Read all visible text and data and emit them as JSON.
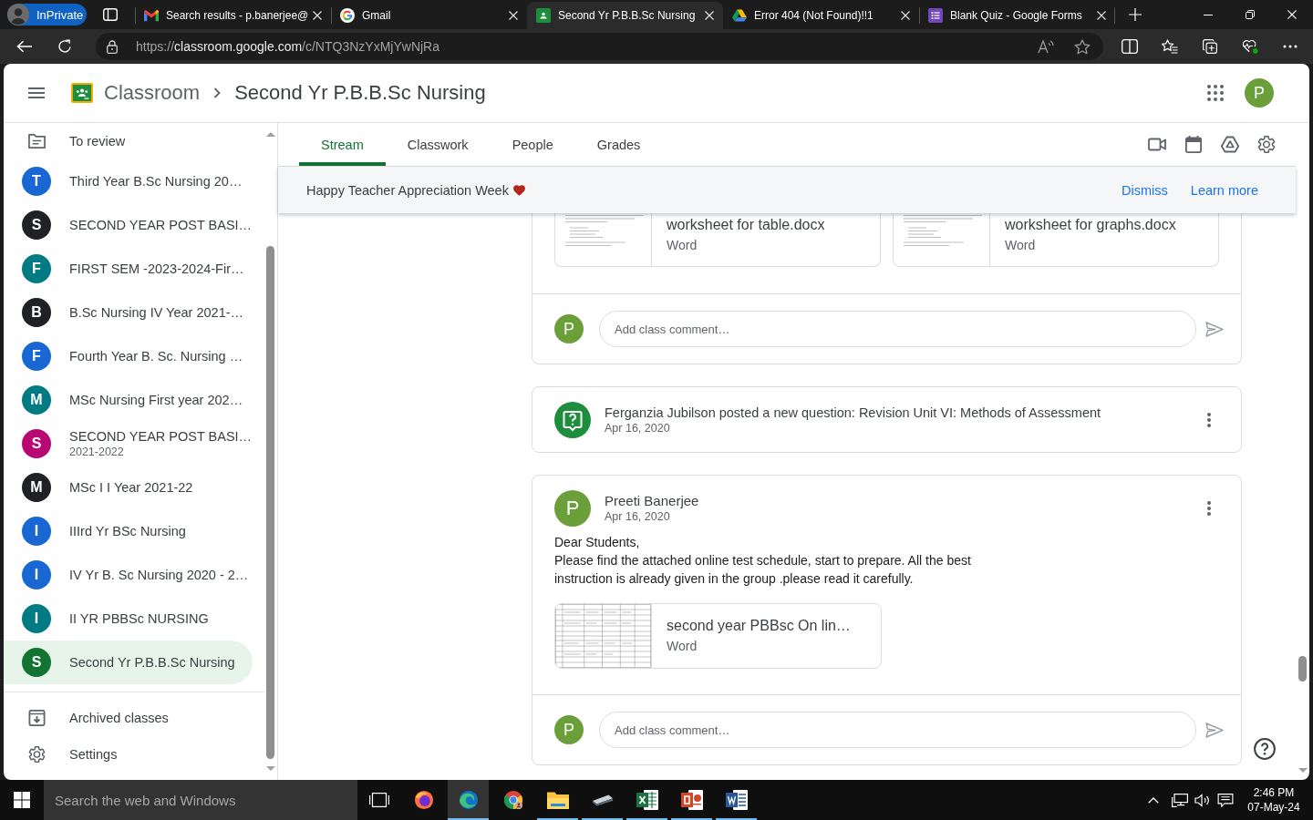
{
  "browser": {
    "profile_label": "InPrivate",
    "tabs": [
      {
        "title": "Search results - p.banerjee@",
        "kind": "gmail",
        "selected": false
      },
      {
        "title": "Gmail",
        "kind": "google",
        "selected": false
      },
      {
        "title": "Second Yr P.B.B.Sc Nursing",
        "kind": "classroom",
        "selected": true
      },
      {
        "title": "Error 404 (Not Found)!!1",
        "kind": "drive",
        "selected": false
      },
      {
        "title": "Blank Quiz - Google Forms",
        "kind": "forms",
        "selected": false
      }
    ],
    "address": {
      "scheme": "https://",
      "host": "classroom.google.com",
      "path": "/c/NTQ3NzYxMjYwNjRa"
    }
  },
  "app_bar": {
    "product": "Classroom",
    "breadcrumb": "Second Yr P.B.B.Sc Nursing",
    "account_initial": "P"
  },
  "sidebar": {
    "review_label": "To review",
    "classes": [
      {
        "initial": "T",
        "name": "Third Year B.Sc Nursing 20…",
        "color": "#1967d2",
        "selected": false
      },
      {
        "initial": "S",
        "name": "SECOND YEAR POST BASI…",
        "color": "#202124",
        "selected": false
      },
      {
        "initial": "F",
        "name": "FIRST SEM -2023-2024-Fir…",
        "color": "#007b83",
        "selected": false
      },
      {
        "initial": "B",
        "name": "B.Sc Nursing IV Year 2021-…",
        "color": "#202124",
        "selected": false
      },
      {
        "initial": "F",
        "name": "Fourth Year B. Sc. Nursing …",
        "color": "#1967d2",
        "selected": false
      },
      {
        "initial": "M",
        "name": "MSc Nursing First year 202…",
        "color": "#007b83",
        "selected": false
      },
      {
        "initial": "S",
        "name": "SECOND YEAR POST BASI…",
        "subtitle": "2021-2022",
        "color": "#b80672",
        "selected": false
      },
      {
        "initial": "M",
        "name": "MSc I I Year 2021-22",
        "color": "#202124",
        "selected": false
      },
      {
        "initial": "I",
        "name": "IIIrd Yr BSc Nursing",
        "color": "#1967d2",
        "selected": false
      },
      {
        "initial": "I",
        "name": "IV Yr B. Sc Nursing 2020 - 2…",
        "color": "#1967d2",
        "selected": false
      },
      {
        "initial": "I",
        "name": "II YR PBBSc NURSING",
        "color": "#007b83",
        "selected": false
      },
      {
        "initial": "S",
        "name": "Second Yr P.B.B.Sc Nursing",
        "color": "#137333",
        "selected": true
      }
    ],
    "footer": [
      {
        "label": "Archived classes",
        "kind": "archive"
      },
      {
        "label": "Settings",
        "kind": "settings"
      }
    ]
  },
  "class_tabs": [
    {
      "label": "Stream",
      "selected": true
    },
    {
      "label": "Classwork",
      "selected": false
    },
    {
      "label": "People",
      "selected": false
    },
    {
      "label": "Grades",
      "selected": false
    }
  ],
  "banner": {
    "message": "Happy Teacher Appreciation Week",
    "actions": [
      "Dismiss",
      "Learn more"
    ]
  },
  "stream": [
    {
      "kind": "post_partial",
      "attachments": [
        {
          "title": "worksheet for table.docx",
          "type": "Word",
          "kind": "text"
        },
        {
          "title": "worksheet for graphs.docx",
          "type": "Word",
          "kind": "text"
        }
      ],
      "comment": {
        "avatar_initial": "P",
        "placeholder": "Add class comment…"
      }
    },
    {
      "kind": "question",
      "text": "Ferganzia Jubilson posted a new question: Revision Unit VI: Methods of Assessment",
      "date": "Apr 16, 2020"
    },
    {
      "kind": "post",
      "author": "Preeti Banerjee",
      "avatar_initial": "P",
      "date": "Apr 16, 2020",
      "body": "Dear Students,\nPlease find the attached online test schedule, start to prepare. All the best\ninstruction is already given in the group .please read it carefully.",
      "attachments": [
        {
          "title": "second year PBBsc On lin…",
          "type": "Word",
          "kind": "table"
        }
      ],
      "comment": {
        "avatar_initial": "P",
        "placeholder": "Add class comment…"
      }
    }
  ],
  "taskbar": {
    "search_placeholder": "Search the web and Windows",
    "apps": [
      {
        "kind": "firefox",
        "running": false,
        "active": false
      },
      {
        "kind": "edge",
        "running": true,
        "active": true
      },
      {
        "kind": "chrome",
        "running": false,
        "active": false
      },
      {
        "kind": "explorer",
        "running": true,
        "active": false
      },
      {
        "kind": "scanner",
        "running": true,
        "active": false
      },
      {
        "kind": "excel",
        "running": true,
        "active": false
      },
      {
        "kind": "powerpoint",
        "running": true,
        "active": false
      },
      {
        "kind": "word",
        "running": true,
        "active": false
      }
    ],
    "time": "2:46 PM",
    "date": "07-May-24"
  }
}
